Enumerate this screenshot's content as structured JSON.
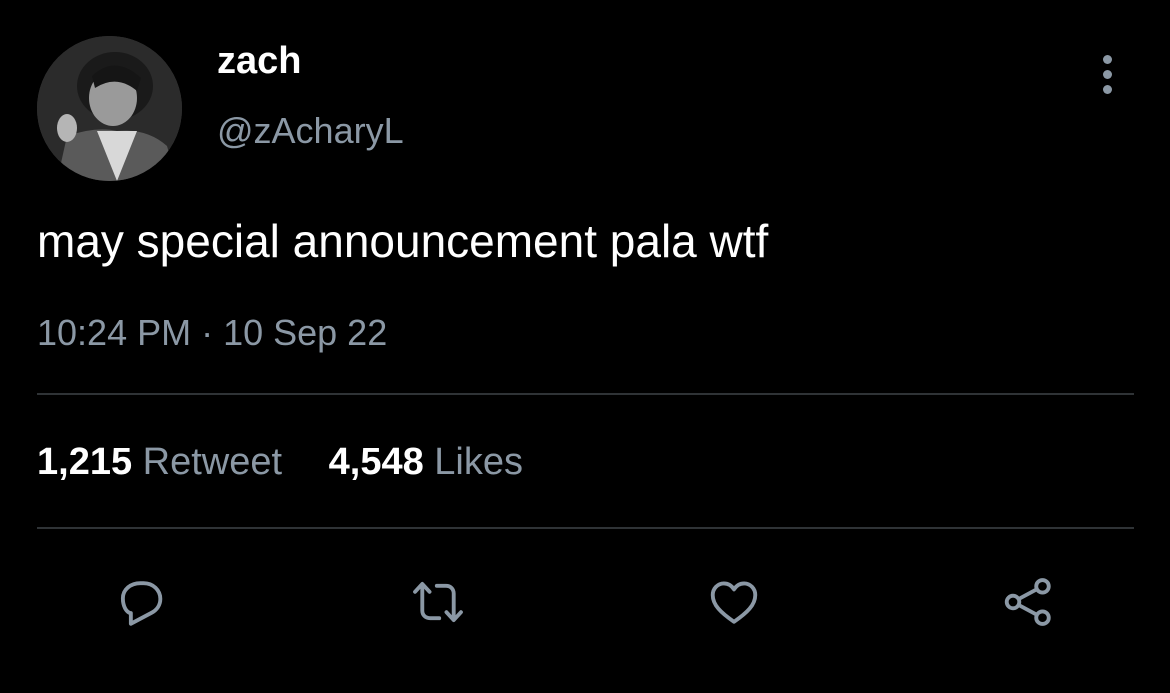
{
  "tweet": {
    "display_name": "zach",
    "handle": "@zAcharyL",
    "text": "may special announcement pala wtf",
    "timestamp": "10:24 PM · 10 Sep 22"
  },
  "stats": {
    "retweets_count": "1,215",
    "retweets_label": "Retweet",
    "likes_count": "4,548",
    "likes_label": "Likes"
  },
  "icons": {
    "more": "more-vertical-icon",
    "reply": "reply-icon",
    "retweet": "retweet-icon",
    "like": "heart-icon",
    "share": "share-icon"
  },
  "colors": {
    "background": "#000000",
    "primary_text": "#ffffff",
    "secondary_text": "#8b98a5",
    "divider": "#2f3336"
  }
}
